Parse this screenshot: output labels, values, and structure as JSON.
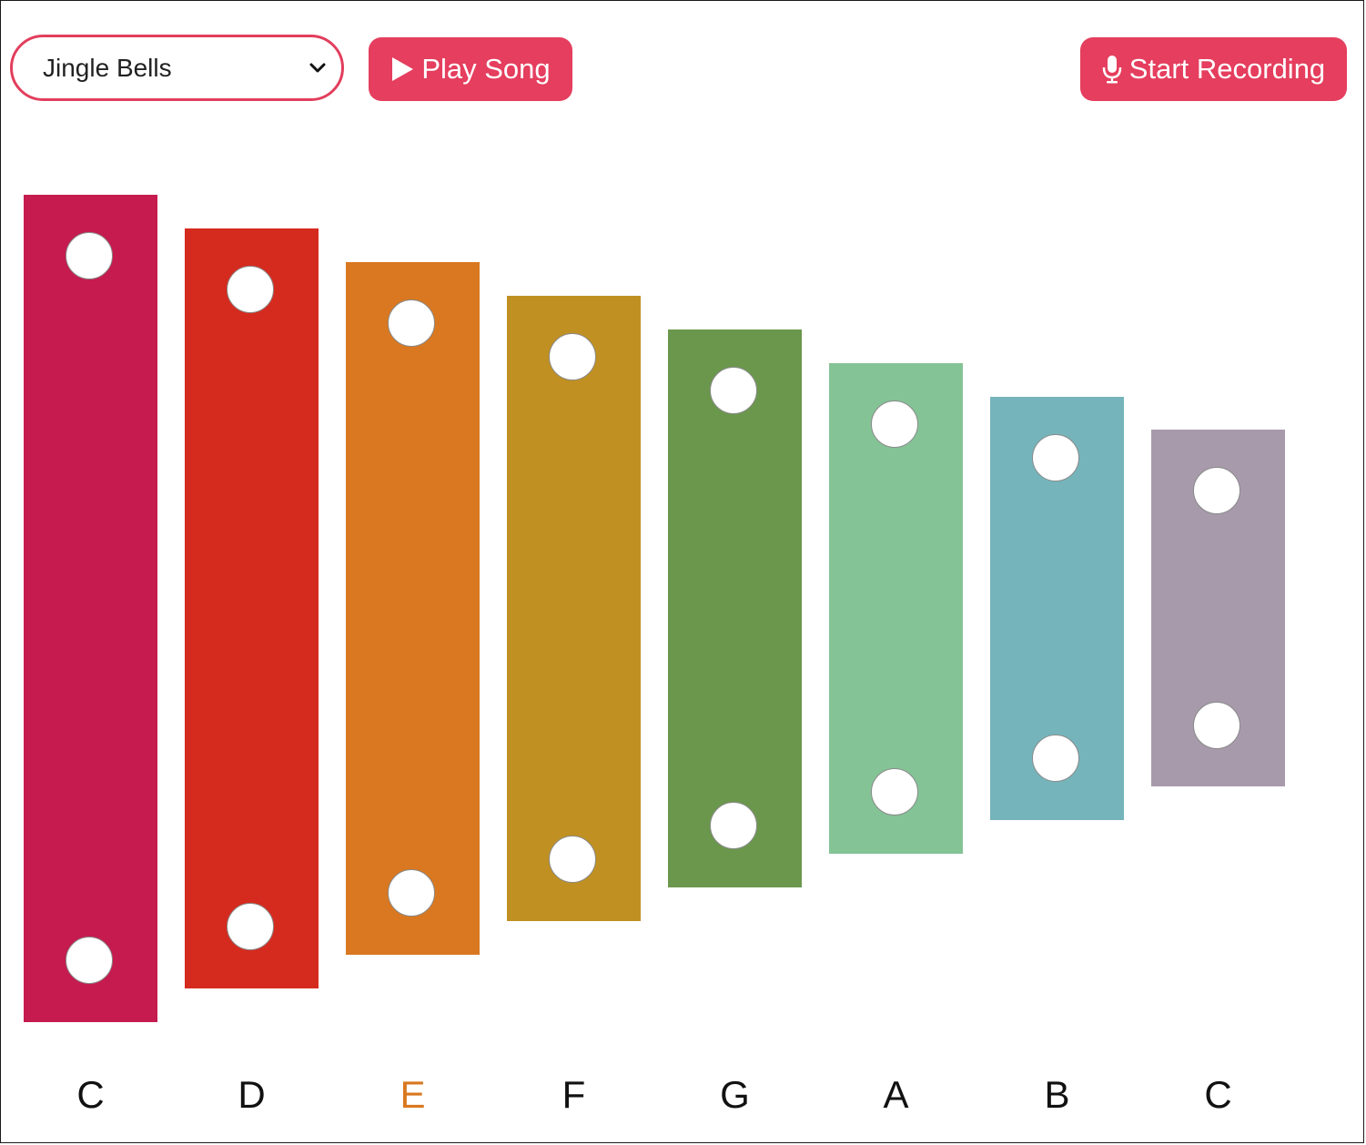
{
  "controls": {
    "song_select": {
      "value": "Jingle Bells",
      "icon": "chevron-down-icon"
    },
    "play_button": {
      "label": "Play Song",
      "icon": "play-icon"
    },
    "record_button": {
      "label": "Start Recording",
      "icon": "microphone-icon"
    }
  },
  "theme": {
    "accent": "#e53e5e",
    "highlight_label_color": "#d97820"
  },
  "keys": [
    {
      "note": "C",
      "color": "#c51b4e",
      "highlighted": false
    },
    {
      "note": "D",
      "color": "#d52b1f",
      "highlighted": false
    },
    {
      "note": "E",
      "color": "#d97820",
      "highlighted": true
    },
    {
      "note": "F",
      "color": "#c09022",
      "highlighted": false
    },
    {
      "note": "G",
      "color": "#6b974d",
      "highlighted": false
    },
    {
      "note": "A",
      "color": "#84c396",
      "highlighted": false
    },
    {
      "note": "B",
      "color": "#76b4bb",
      "highlighted": false
    },
    {
      "note": "C",
      "color": "#a79aab",
      "highlighted": false
    }
  ]
}
